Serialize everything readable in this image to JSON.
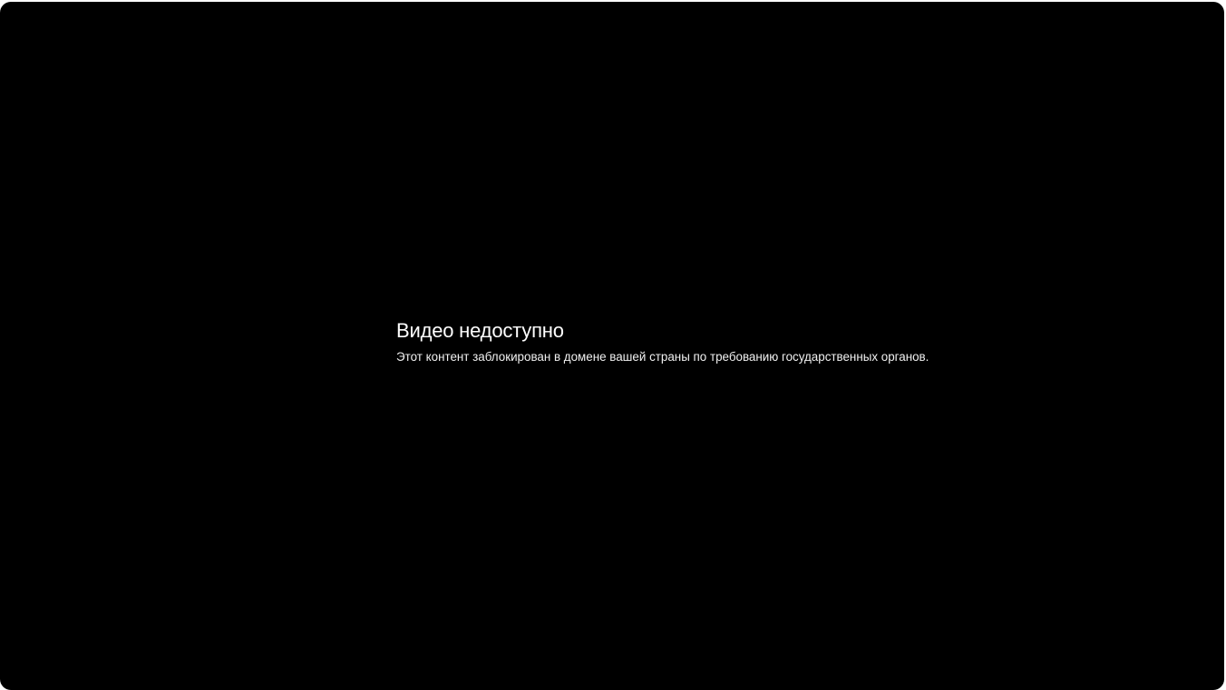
{
  "player": {
    "background_color": "#000000",
    "error": {
      "title": "Видео недоступно",
      "message": "Этот контент заблокирован в домене вашей страны по требованию государственных органов.",
      "text_color": "#ffffff"
    }
  }
}
